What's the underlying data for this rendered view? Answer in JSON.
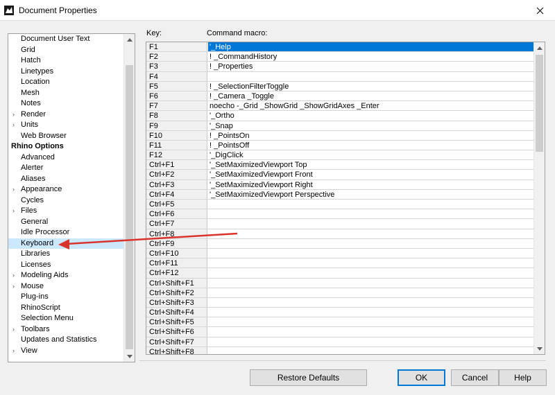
{
  "window": {
    "title": "Document Properties"
  },
  "tree": {
    "items": [
      {
        "label": "Document User Text",
        "expand": false
      },
      {
        "label": "Grid",
        "expand": false
      },
      {
        "label": "Hatch",
        "expand": false
      },
      {
        "label": "Linetypes",
        "expand": false
      },
      {
        "label": "Location",
        "expand": false
      },
      {
        "label": "Mesh",
        "expand": false
      },
      {
        "label": "Notes",
        "expand": false
      },
      {
        "label": "Render",
        "expand": true
      },
      {
        "label": "Units",
        "expand": true
      },
      {
        "label": "Web Browser",
        "expand": false
      },
      {
        "label": "Rhino Options",
        "header": true
      },
      {
        "label": "Advanced",
        "expand": false
      },
      {
        "label": "Alerter",
        "expand": false
      },
      {
        "label": "Aliases",
        "expand": false
      },
      {
        "label": "Appearance",
        "expand": true
      },
      {
        "label": "Cycles",
        "expand": false
      },
      {
        "label": "Files",
        "expand": true
      },
      {
        "label": "General",
        "expand": false
      },
      {
        "label": "Idle Processor",
        "expand": false
      },
      {
        "label": "Keyboard",
        "expand": false,
        "selected": true
      },
      {
        "label": "Libraries",
        "expand": false
      },
      {
        "label": "Licenses",
        "expand": false
      },
      {
        "label": "Modeling Aids",
        "expand": true
      },
      {
        "label": "Mouse",
        "expand": true
      },
      {
        "label": "Plug-ins",
        "expand": false
      },
      {
        "label": "RhinoScript",
        "expand": false
      },
      {
        "label": "Selection Menu",
        "expand": false
      },
      {
        "label": "Toolbars",
        "expand": true
      },
      {
        "label": "Updates and Statistics",
        "expand": false
      },
      {
        "label": "View",
        "expand": true
      }
    ]
  },
  "grid": {
    "key_header": "Key:",
    "macro_header": "Command macro:",
    "rows": [
      {
        "key": "F1",
        "macro": "'_Help",
        "selected": true
      },
      {
        "key": "F2",
        "macro": "! _CommandHistory"
      },
      {
        "key": "F3",
        "macro": "! _Properties"
      },
      {
        "key": "F4",
        "macro": ""
      },
      {
        "key": "F5",
        "macro": "! _SelectionFilterToggle"
      },
      {
        "key": "F6",
        "macro": "! _Camera _Toggle"
      },
      {
        "key": "F7",
        "macro": "noecho -_Grid _ShowGrid _ShowGridAxes _Enter"
      },
      {
        "key": "F8",
        "macro": "'_Ortho"
      },
      {
        "key": "F9",
        "macro": "'_Snap"
      },
      {
        "key": "F10",
        "macro": "! _PointsOn"
      },
      {
        "key": "F11",
        "macro": "! _PointsOff"
      },
      {
        "key": "F12",
        "macro": "'_DigClick"
      },
      {
        "key": "Ctrl+F1",
        "macro": "'_SetMaximizedViewport Top"
      },
      {
        "key": "Ctrl+F2",
        "macro": "'_SetMaximizedViewport Front"
      },
      {
        "key": "Ctrl+F3",
        "macro": "'_SetMaximizedViewport Right"
      },
      {
        "key": "Ctrl+F4",
        "macro": "'_SetMaximizedViewport Perspective"
      },
      {
        "key": "Ctrl+F5",
        "macro": ""
      },
      {
        "key": "Ctrl+F6",
        "macro": ""
      },
      {
        "key": "Ctrl+F7",
        "macro": ""
      },
      {
        "key": "Ctrl+F8",
        "macro": ""
      },
      {
        "key": "Ctrl+F9",
        "macro": ""
      },
      {
        "key": "Ctrl+F10",
        "macro": ""
      },
      {
        "key": "Ctrl+F11",
        "macro": ""
      },
      {
        "key": "Ctrl+F12",
        "macro": ""
      },
      {
        "key": "Ctrl+Shift+F1",
        "macro": ""
      },
      {
        "key": "Ctrl+Shift+F2",
        "macro": ""
      },
      {
        "key": "Ctrl+Shift+F3",
        "macro": ""
      },
      {
        "key": "Ctrl+Shift+F4",
        "macro": ""
      },
      {
        "key": "Ctrl+Shift+F5",
        "macro": ""
      },
      {
        "key": "Ctrl+Shift+F6",
        "macro": ""
      },
      {
        "key": "Ctrl+Shift+F7",
        "macro": ""
      },
      {
        "key": "Ctrl+Shift+F8",
        "macro": ""
      }
    ]
  },
  "buttons": {
    "restore_defaults": "Restore Defaults",
    "ok": "OK",
    "cancel": "Cancel",
    "help": "Help"
  },
  "colors": {
    "selection_blue": "#0078d7",
    "tree_selection": "#cce8ff",
    "annotation_arrow": "#d9342b"
  }
}
